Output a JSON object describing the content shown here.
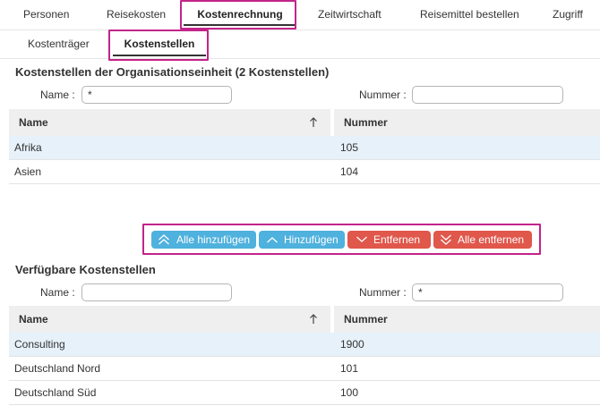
{
  "top_tabs": [
    {
      "label": "Personen"
    },
    {
      "label": "Reisekosten"
    },
    {
      "label": "Kostenrechnung"
    },
    {
      "label": "Zeitwirtschaft"
    },
    {
      "label": "Reisemittel bestellen"
    },
    {
      "label": "Zugriff"
    }
  ],
  "sub_tabs": [
    {
      "label": "Kostenträger"
    },
    {
      "label": "Kostenstellen"
    }
  ],
  "assigned": {
    "title": "Kostenstellen der Organisationseinheit (2 Kostenstellen)",
    "name_label": "Name :",
    "name_value": "*",
    "number_label": "Nummer :",
    "number_value": "",
    "columns": {
      "name": "Name",
      "number": "Nummer"
    },
    "rows": [
      {
        "name": "Afrika",
        "number": "105"
      },
      {
        "name": "Asien",
        "number": "104"
      }
    ]
  },
  "actions": {
    "add_all": "Alle hinzufügen",
    "add": "Hinzufügen",
    "remove": "Entfernen",
    "remove_all": "Alle entfernen",
    "colors": {
      "add": "#4fb1dd",
      "remove": "#e0574b",
      "highlight": "#c2248a"
    }
  },
  "available": {
    "title": "Verfügbare Kostenstellen",
    "name_label": "Name :",
    "name_value": "",
    "number_label": "Nummer :",
    "number_value": "*",
    "columns": {
      "name": "Name",
      "number": "Nummer"
    },
    "rows": [
      {
        "name": "Consulting",
        "number": "1900"
      },
      {
        "name": "Deutschland Nord",
        "number": "101"
      },
      {
        "name": "Deutschland Süd",
        "number": "100"
      }
    ]
  }
}
